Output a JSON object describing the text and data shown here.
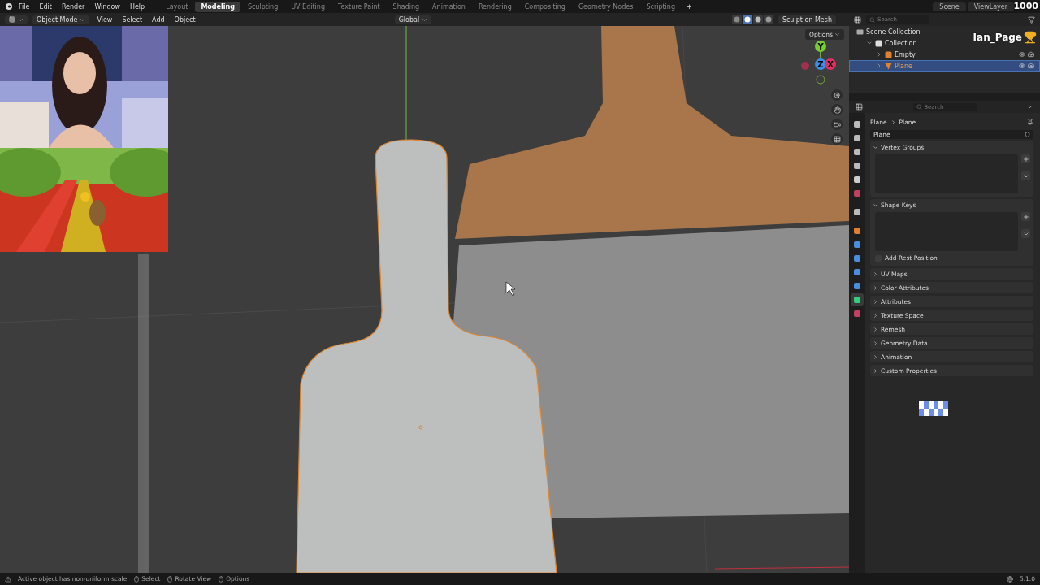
{
  "menu_bar": {
    "menus": [
      "File",
      "Edit",
      "Render",
      "Window",
      "Help"
    ],
    "workspaces": [
      {
        "label": "Layout",
        "selected": false
      },
      {
        "label": "Modeling",
        "selected": true
      },
      {
        "label": "Sculpting",
        "selected": false
      },
      {
        "label": "UV Editing",
        "selected": false
      },
      {
        "label": "Texture Paint",
        "selected": false
      },
      {
        "label": "Shading",
        "selected": false
      },
      {
        "label": "Animation",
        "selected": false
      },
      {
        "label": "Rendering",
        "selected": false
      },
      {
        "label": "Compositing",
        "selected": false
      },
      {
        "label": "Geometry Nodes",
        "selected": false
      },
      {
        "label": "Scripting",
        "selected": false
      }
    ],
    "add_tab": "+",
    "scene": "Scene",
    "view_layer": "ViewLayer"
  },
  "viewport_header": {
    "mode": "Object Mode",
    "menus": [
      "View",
      "Select",
      "Add",
      "Object"
    ],
    "orientation": "Global",
    "sculpt_button": "Sculpt on Mesh",
    "shading": [
      {
        "kind": "wireframe",
        "selected": false
      },
      {
        "kind": "solid",
        "selected": true
      },
      {
        "kind": "material",
        "selected": false
      },
      {
        "kind": "rendered",
        "selected": false
      }
    ]
  },
  "viewport": {
    "options": "Options",
    "gizmo": {
      "y": "Y",
      "z": "Z",
      "x": "X"
    }
  },
  "stream_overlay": {
    "username": "Ian_Page",
    "score": "1000"
  },
  "outliner": {
    "search_placeholder": "Search",
    "tree": [
      {
        "label": "Scene Collection",
        "kind": "scene",
        "children": [
          {
            "label": "Collection",
            "kind": "collection",
            "expanded": true,
            "children": [
              {
                "label": "Empty",
                "kind": "empty",
                "selected": false,
                "expanded": false
              },
              {
                "label": "Plane",
                "kind": "mesh",
                "selected": true,
                "expanded": false
              }
            ]
          }
        ]
      }
    ]
  },
  "properties": {
    "search_placeholder": "Search",
    "breadcrumb": [
      "Plane",
      "Plane"
    ],
    "data_name": "Plane",
    "tabs": [
      {
        "kind": "tool",
        "selected": false
      },
      {
        "kind": "render",
        "selected": false
      },
      {
        "kind": "output",
        "selected": false
      },
      {
        "kind": "view",
        "selected": false
      },
      {
        "kind": "scene",
        "selected": false
      },
      {
        "kind": "world",
        "selected": false
      },
      {
        "kind": "collection",
        "selected": false
      },
      {
        "kind": "object",
        "selected": false
      },
      {
        "kind": "modifier",
        "selected": false
      },
      {
        "kind": "particles",
        "selected": false
      },
      {
        "kind": "physics",
        "selected": false
      },
      {
        "kind": "constraints",
        "selected": false
      },
      {
        "kind": "data",
        "selected": true
      },
      {
        "kind": "material",
        "selected": false
      }
    ],
    "panels": [
      {
        "title": "Vertex Groups",
        "expanded": true
      },
      {
        "title": "Shape Keys",
        "expanded": true,
        "checkbox": {
          "label": "Add Rest Position",
          "checked": false
        }
      },
      {
        "title": "UV Maps",
        "expanded": false
      },
      {
        "title": "Color Attributes",
        "expanded": false
      },
      {
        "title": "Attributes",
        "expanded": false
      },
      {
        "title": "Texture Space",
        "expanded": false
      },
      {
        "title": "Remesh",
        "expanded": false
      },
      {
        "title": "Geometry Data",
        "expanded": false
      },
      {
        "title": "Animation",
        "expanded": false
      },
      {
        "title": "Custom Properties",
        "expanded": false
      }
    ]
  },
  "status_bar": {
    "message": "Active object has non-uniform scale",
    "hints": [
      "Select",
      "Rotate View",
      "Options"
    ],
    "version": "5.1.0"
  }
}
